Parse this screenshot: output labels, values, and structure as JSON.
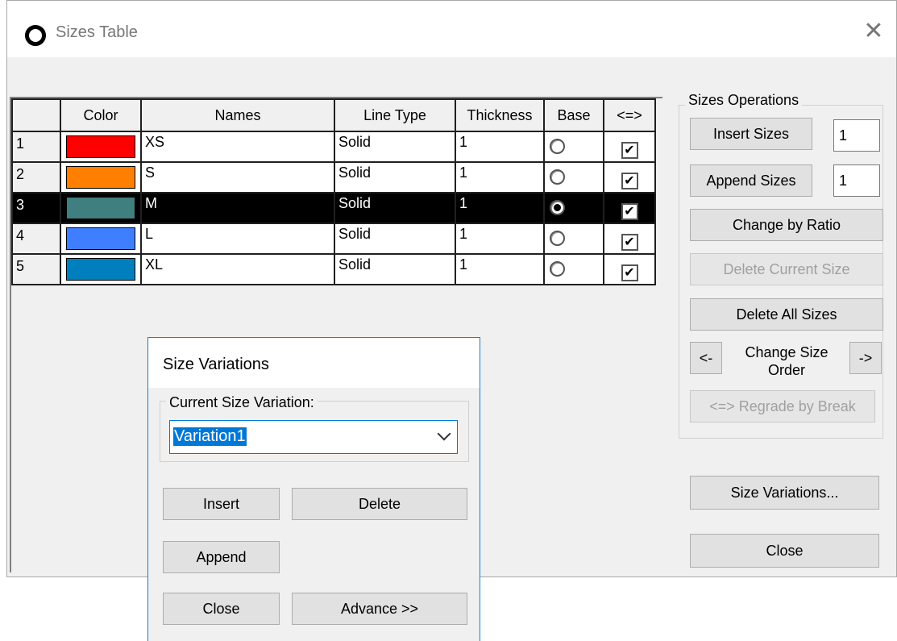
{
  "window": {
    "title": "Sizes Table",
    "close_glyph": "✕"
  },
  "grid": {
    "headers": [
      "",
      "Color",
      "Names",
      "Line Type",
      "Thickness",
      "Base",
      "<=>"
    ],
    "rows": [
      {
        "num": "1",
        "color": "#ff0000",
        "name": "XS",
        "line_type": "Solid",
        "thickness": "1",
        "base": false,
        "checked": true,
        "selected": false
      },
      {
        "num": "2",
        "color": "#ff7f00",
        "name": "S",
        "line_type": "Solid",
        "thickness": "1",
        "base": false,
        "checked": true,
        "selected": false
      },
      {
        "num": "3",
        "color": "#3f7f7f",
        "name": "M",
        "line_type": "Solid",
        "thickness": "1",
        "base": true,
        "checked": true,
        "selected": true
      },
      {
        "num": "4",
        "color": "#3f7fff",
        "name": "L",
        "line_type": "Solid",
        "thickness": "1",
        "base": false,
        "checked": true,
        "selected": false
      },
      {
        "num": "5",
        "color": "#007fbf",
        "name": "XL",
        "line_type": "Solid",
        "thickness": "1",
        "base": false,
        "checked": true,
        "selected": false
      }
    ]
  },
  "operations": {
    "label": "Sizes Operations",
    "insert_sizes": "Insert Sizes",
    "insert_count": "1",
    "append_sizes": "Append Sizes",
    "append_count": "1",
    "change_by_ratio": "Change by Ratio",
    "delete_current_size": "Delete Current Size",
    "delete_all_sizes": "Delete All Sizes",
    "order_left": "<-",
    "change_size_order": "Change Size Order",
    "order_right": "->",
    "regrade_by_break": "<=> Regrade by Break",
    "size_variations": "Size Variations...",
    "close": "Close"
  },
  "dialog": {
    "title": "Size Variations",
    "group_label": "Current Size Variation:",
    "current_value": "Variation1",
    "insert": "Insert",
    "delete": "Delete",
    "append": "Append",
    "close": "Close",
    "advance": "Advance >>"
  },
  "colors": {
    "accent": "#0078d7",
    "selected_row": "#000000",
    "button_bg": "#e1e1e1"
  }
}
